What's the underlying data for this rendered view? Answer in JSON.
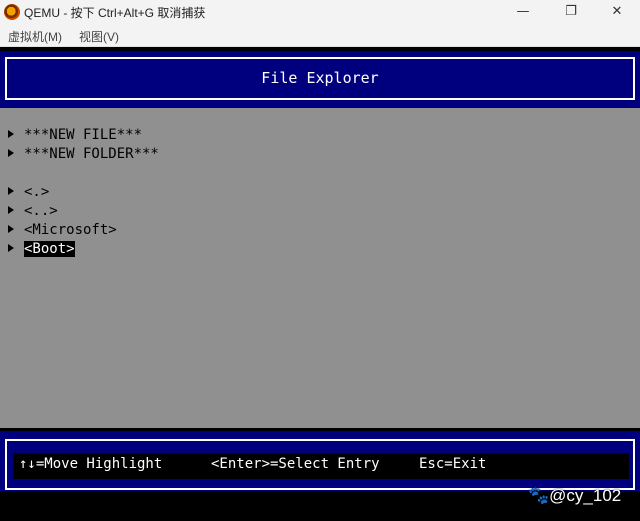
{
  "window": {
    "title": "QEMU - 按下 Ctrl+Alt+G 取消捕获",
    "controls": {
      "minimize": "—",
      "restore": "❐",
      "close": "✕"
    }
  },
  "menu": {
    "vm": "虚拟机(M)",
    "view": "视图(V)"
  },
  "screen": {
    "header_title": "File Explorer",
    "colors": {
      "band": "#00007f",
      "content_bg": "#909090"
    },
    "entries": [
      {
        "label": "***NEW FILE***",
        "selected": false
      },
      {
        "label": "***NEW FOLDER***",
        "selected": false
      },
      {
        "label": "<.>",
        "selected": false
      },
      {
        "label": "<..>",
        "selected": false
      },
      {
        "label": "<Microsoft>",
        "selected": false
      },
      {
        "label": "<Boot>",
        "selected": true
      }
    ],
    "footer": {
      "hint_move": "↑↓=Move Highlight",
      "hint_enter": "<Enter>=Select Entry",
      "hint_exit": "Esc=Exit"
    }
  },
  "watermark": "🐾@cy_102"
}
